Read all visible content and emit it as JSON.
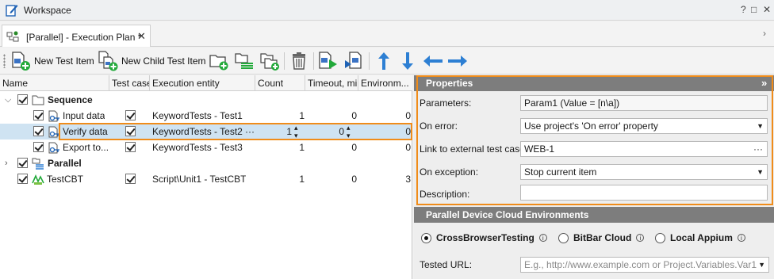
{
  "window": {
    "title": "Workspace",
    "help_glyph": "?",
    "minimize_glyph": "□",
    "close_glyph": "✕"
  },
  "tab": {
    "label": "[Parallel] - Execution Plan *",
    "close_glyph": "✕",
    "scroll_glyph": "›"
  },
  "toolbar": {
    "new_test_item": "New Test Item",
    "new_child_test_item": "New Child Test Item"
  },
  "grid": {
    "columns": [
      "Name",
      "Test case",
      "Execution entity",
      "Count",
      "Timeout, min",
      "Environm..."
    ],
    "rows": [
      {
        "name": "Sequence",
        "bold": true,
        "entity": "",
        "count": "",
        "timeout": "",
        "env": "",
        "testcase": false
      },
      {
        "name": "Input data",
        "entity": "KeywordTests - Test1",
        "count": "1",
        "timeout": "0",
        "env": "0",
        "testcase": true
      },
      {
        "name": "Verify data",
        "entity": "KeywordTests - Test2",
        "entity_suffix": "···",
        "count": "1",
        "timeout": "0",
        "env": "0",
        "testcase": true
      },
      {
        "name": "Export to...",
        "entity": "KeywordTests - Test3",
        "count": "1",
        "timeout": "0",
        "env": "0",
        "testcase": true
      },
      {
        "name": "Parallel",
        "bold": true,
        "entity": "",
        "count": "",
        "timeout": "",
        "env": "",
        "testcase": false
      },
      {
        "name": "TestCBT",
        "entity": "Script\\Unit1 - TestCBT",
        "count": "1",
        "timeout": "0",
        "env": "3",
        "testcase": true
      }
    ]
  },
  "properties": {
    "title": "Properties",
    "collapse_glyph": "»",
    "parameters_label": "Parameters:",
    "parameters_value": "Param1 (Value = [n\\a])",
    "on_error_label": "On error:",
    "on_error_value": "Use project's 'On error' property",
    "link_label": "Link to external test case:",
    "link_value": "WEB-1",
    "link_ellipsis": "···",
    "on_exception_label": "On exception:",
    "on_exception_value": "Stop current item",
    "description_label": "Description:",
    "description_value": ""
  },
  "cloud": {
    "title": "Parallel Device Cloud Environments",
    "options": [
      "CrossBrowserTesting",
      "BitBar Cloud",
      "Local Appium"
    ],
    "selected": "CrossBrowserTesting",
    "info_glyph": "i",
    "tested_url_label": "Tested URL:",
    "tested_url_placeholder": "E.g., http://www.example.com or Project.Variables.Var1"
  },
  "colors": {
    "highlight": "#f08c1a",
    "selected_row": "#cfe3f2",
    "panel_header": "#7d7d7d"
  }
}
